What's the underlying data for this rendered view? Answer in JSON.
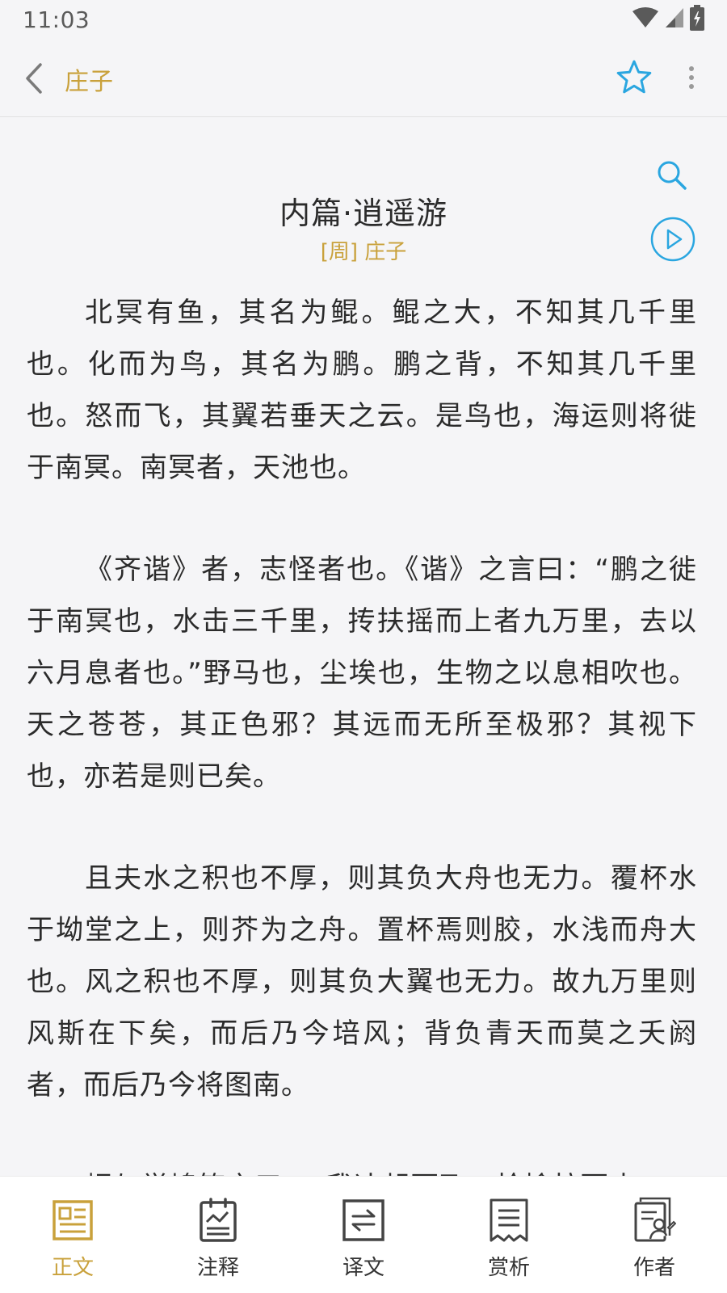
{
  "status_bar": {
    "time": "11:03"
  },
  "app_bar": {
    "title": "庄子"
  },
  "poem": {
    "title": "内篇·逍遥游",
    "author": "[周] 庄子",
    "paragraphs": [
      "北冥有鱼，其名为鲲。鲲之大，不知其几千里也。化而为鸟，其名为鹏。鹏之背，不知其几千里也。怒而飞，其翼若垂天之云。是鸟也，海运则将徙于南冥。南冥者，天池也。",
      "《齐谐》者，志怪者也。《谐》之言曰：“鹏之徙于南冥也，水击三千里，抟扶摇而上者九万里，去以六月息者也。”野马也，尘埃也，生物之以息相吹也。天之苍苍，其正色邪？其远而无所至极邪？其视下也，亦若是则已矣。",
      "且夫水之积也不厚，则其负大舟也无力。覆杯水于坳堂之上，则芥为之舟。置杯焉则胶，水浅而舟大也。风之积也不厚，则其负大翼也无力。故九万里则风斯在下矣，而后乃今培风；背负青天而莫之夭阏者，而后乃今将图南。",
      "蜩与学鸠笑之曰：“我决起而飞，抢榆枋而止，"
    ]
  },
  "bottom_nav": {
    "items": [
      {
        "label": "正文",
        "icon": "text-icon",
        "active": true
      },
      {
        "label": "注释",
        "icon": "annotation-icon",
        "active": false
      },
      {
        "label": "译文",
        "icon": "translation-icon",
        "active": false
      },
      {
        "label": "赏析",
        "icon": "appreciation-icon",
        "active": false
      },
      {
        "label": "作者",
        "icon": "author-icon",
        "active": false
      }
    ]
  },
  "colors": {
    "accent": "#c9a13b",
    "link_blue": "#2aa6e0",
    "text": "#2b2b2b",
    "background": "#f5f5f7"
  }
}
